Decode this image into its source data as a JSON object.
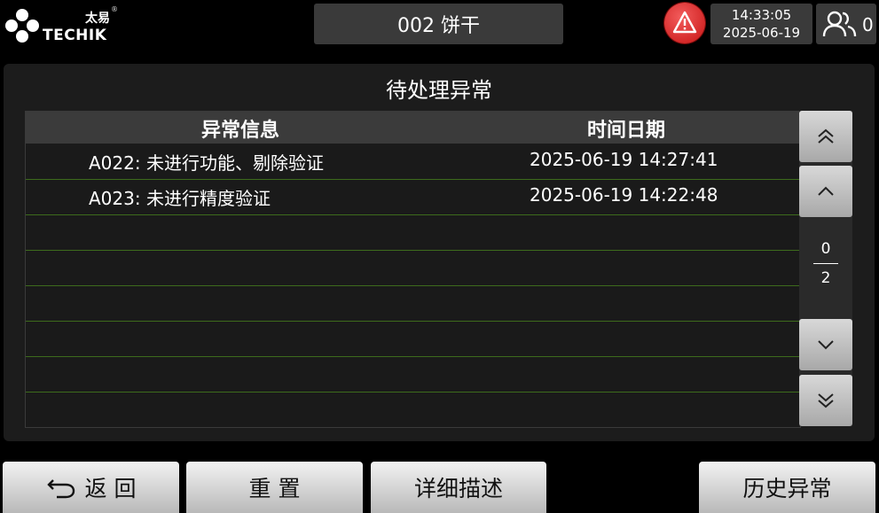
{
  "brand": {
    "cn": "太易",
    "reg": "®",
    "en": "TECHIK"
  },
  "header": {
    "product": "002 饼干",
    "time": "14:33:05",
    "date": "2025-06-19",
    "user_count": "0",
    "alarm_color": "#d42020"
  },
  "panel": {
    "title": "待处理异常",
    "columns": {
      "info": "异常信息",
      "time": "时间日期"
    },
    "rows": [
      {
        "info": "A022: 未进行功能、剔除验证",
        "time": "2025-06-19 14:27:41"
      },
      {
        "info": "A023: 未进行精度验证",
        "time": "2025-06-19 14:22:48"
      }
    ],
    "pager": {
      "current": "0",
      "total": "2"
    }
  },
  "footer": {
    "back": "返 回",
    "reset": "重 置",
    "detail": "详细描述",
    "history": "历史异常"
  }
}
